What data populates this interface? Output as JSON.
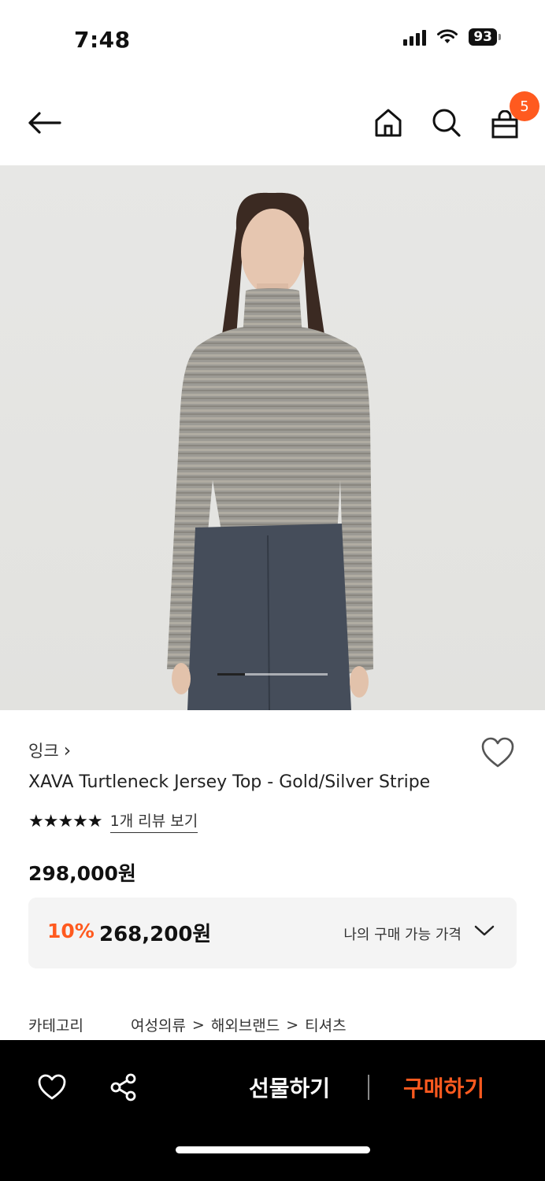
{
  "status_bar": {
    "time": "7:48",
    "battery": "93"
  },
  "header": {
    "cart_count": "5"
  },
  "product": {
    "brand": "잉크",
    "brand_chevron": "›",
    "title": "XAVA Turtleneck Jersey Top - Gold/Silver Stripe",
    "stars": "★★★★★",
    "review_link": "1개 리뷰 보기",
    "price": "298,000원",
    "discount_percent": "10%",
    "discount_price": "268,200원",
    "my_price_label": "나의 구매 가능 가격"
  },
  "category": {
    "label": "카테고리",
    "path": [
      "여성의류",
      "해외브랜드",
      "티셔츠"
    ],
    "separator": ">"
  },
  "bottom_bar": {
    "gift_label": "선물하기",
    "buy_label": "구매하기"
  },
  "carousel": {
    "current": 1,
    "total": 4
  },
  "colors": {
    "accent": "#ff5a1f",
    "bottom_bar_bg": "#000000",
    "price_box_bg": "#f4f4f4"
  },
  "icons": [
    "back-arrow-icon",
    "home-icon",
    "search-icon",
    "shopping-bag-icon",
    "heart-icon",
    "share-icon",
    "chevron-down-icon"
  ]
}
